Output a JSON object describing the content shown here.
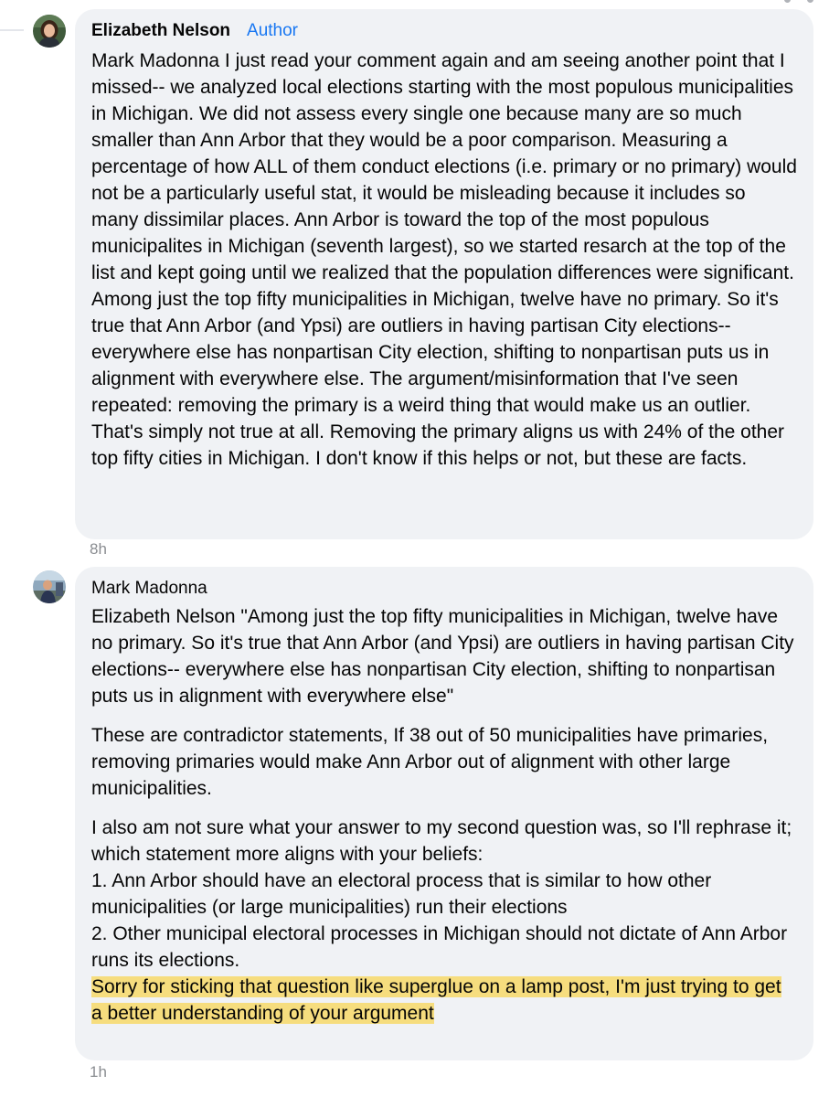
{
  "comments": [
    {
      "author": "Elizabeth Nelson",
      "badge": "Author",
      "text": "Mark Madonna I just read your comment again and am seeing another point that I missed-- we analyzed local elections starting with the most populous municipalities in Michigan. We did not assess every single one because many are so much smaller than Ann Arbor that they would be a poor comparison. Measuring a percentage of how ALL of them conduct elections (i.e. primary or no primary) would not be a particularly useful stat, it would be misleading because it includes so many dissimilar places. Ann Arbor is toward the top of the most populous municipalites in Michigan (seventh largest), so we started resarch at the top of the list and kept going until we realized that the population differences were significant. Among just the top fifty municipalities in Michigan, twelve have no primary. So it's true that Ann Arbor (and Ypsi) are outliers in having partisan City elections-- everywhere else has nonpartisan City election, shifting to nonpartisan puts us in alignment with everywhere else. The argument/misinformation that I've seen repeated: removing the primary is a weird thing that would make us an outlier. That's simply not true at all. Removing the primary aligns us with 24% of the other top fifty cities in Michigan. I don't know if this helps or not, but these are facts.",
      "timestamp": "8h"
    },
    {
      "author": "Mark Madonna",
      "paragraph_1": "Elizabeth Nelson \"Among just the top fifty municipalities in Michigan, twelve have no primary. So it's true that Ann Arbor (and Ypsi) are outliers in having partisan City elections-- everywhere else has nonpartisan City election, shifting to nonpartisan puts us in alignment with everywhere else\"",
      "paragraph_2": "These are contradictor statements, If 38 out of 50 municipalities have primaries, removing primaries would make Ann Arbor out of alignment with other large municipalities.",
      "paragraph_3_lines": [
        "I also am not sure what your answer to my second question was, so I'll rephrase it; which statement more aligns with your beliefs:",
        "1. Ann Arbor should have an electoral process that is similar to how other municipalities (or large municipalities) run their elections",
        "2. Other municipal electoral processes in Michigan should not dictate of Ann Arbor runs its elections."
      ],
      "highlighted_text": "Sorry for sticking that question like superglue on a lamp post, I'm just trying to get a better understanding of your argument",
      "timestamp": "1h"
    }
  ],
  "colors": {
    "bubble_bg": "#f0f2f5",
    "author_badge": "#1877f2",
    "highlight": "#f6dd7e",
    "timestamp": "#8a8d91"
  },
  "icons": [
    "avatar-elizabeth",
    "avatar-mark"
  ]
}
